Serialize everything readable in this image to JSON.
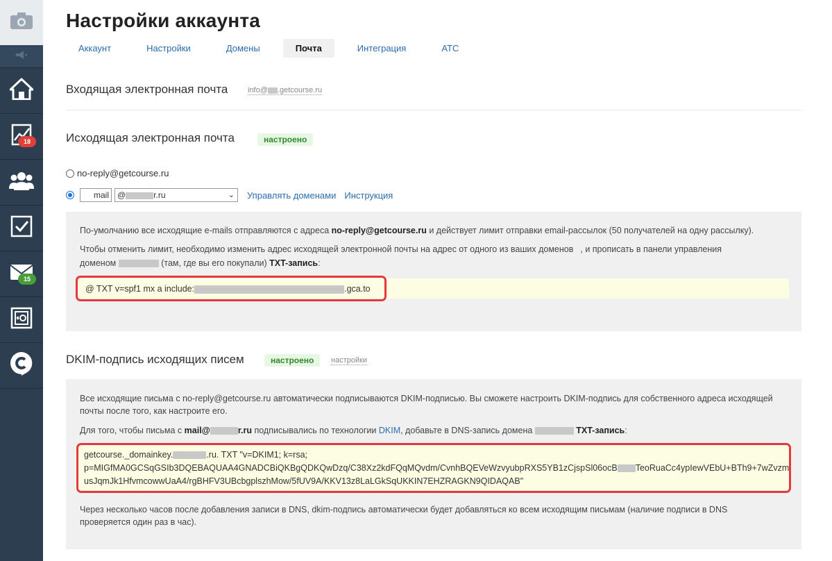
{
  "sidebar": {
    "items": [
      {
        "icon": "camera-icon"
      },
      {
        "icon": "speaker-icon"
      },
      {
        "icon": "home-icon"
      },
      {
        "icon": "chart-icon",
        "badge": "18"
      },
      {
        "icon": "users-icon"
      },
      {
        "icon": "checkbox-icon"
      },
      {
        "icon": "mail-icon",
        "badge": "15"
      },
      {
        "icon": "safe-icon"
      },
      {
        "icon": "getcourse-logo-icon"
      }
    ]
  },
  "header": {
    "title": "Настройки аккаунта",
    "tabs": [
      "Аккаунт",
      "Настройки",
      "Домены",
      "Почта",
      "Интеграция",
      "АТС"
    ],
    "active_tab": "Почта"
  },
  "incoming": {
    "title": "Входящая электронная почта",
    "address_prefix": "info@",
    "address_suffix": ".getcourse.ru"
  },
  "outgoing": {
    "title": "Исходящая электронная почта",
    "status": "настроено",
    "option1": "no-reply@getcourse.ru",
    "mail_value": "mail",
    "domain_prefix": "@",
    "domain_suffix": "r.ru",
    "manage_domains": "Управлять доменами",
    "instruction": "Инструкция",
    "info1_a": "По-умолчанию все исходящие e-mails отправляются с адреса ",
    "info1_b": "no-reply@getcourse.ru",
    "info1_c": " и действует лимит отправки email-рассылок (50 получателей на одну рассылку).",
    "info2_a": "Чтобы отменить лимит, необходимо изменить адрес исходящей электронной почты на адрес от одного из ваших доменов",
    "info2_b": ", и прописать в панели управления",
    "info2_c": "доменом",
    "info2_d": " (там, где вы его покупали) ",
    "info2_e": "TXT-запись",
    "info2_f": ":",
    "txt_prefix": "@ TXT v=spf1 mx a include:",
    "txt_suffix": ".gca.to"
  },
  "dkim": {
    "title": "DKIM-подпись исходящих писем",
    "status": "настроено",
    "settings_link": "настройки",
    "info1": "Все исходящие письма с no-reply@getcourse.ru автоматически подписываются DKIM-подписью. Вы сможете настроить DKIM-подпись для собственного адреса исходящей",
    "info1b": "почты после того, как настроите его.",
    "info2_a": "Для того, чтобы письма с ",
    "info2_b": "mail@",
    "info2_b2": "r.ru",
    "info2_c": " подписывались по технологии ",
    "info2_d": "DKIM",
    "info2_e": ", добавьте в DNS-запись домена ",
    "info2_f": "TXT-запись",
    "info2_g": ":",
    "code_line1_a": "getcourse._domainkey.",
    "code_line1_b": ".ru. TXT \"v=DKIM1; k=rsa;",
    "code_line2_a": "p=MIGfMA0GCSqGSIb3DQEBAQUAA4GNADCBiQKBgQDKQwDzq/C38Xz2kdFQqMQvdm/CvnhBQEVeWzvyubpRXS5YB1zCjspSl06ocB",
    "code_line2_b": "TeoRuaCc4ypIewVEbU+BTh9+7wZvzm",
    "code_line3": "usJqmJk1HfvmcowwUaA4/rgBHFV3UBcbgplszhMow/5fUV9A/KKV13z8LaLGkSqUKKIN7EHZRAGKN9QIDAQAB\"",
    "footer1": "Через несколько часов после добавления записи в DNS, dkim-подпись автоматически будет добавляться ко всем исходящим письмам (наличие подписи в DNS",
    "footer2": "проверяется один раз в час)."
  }
}
